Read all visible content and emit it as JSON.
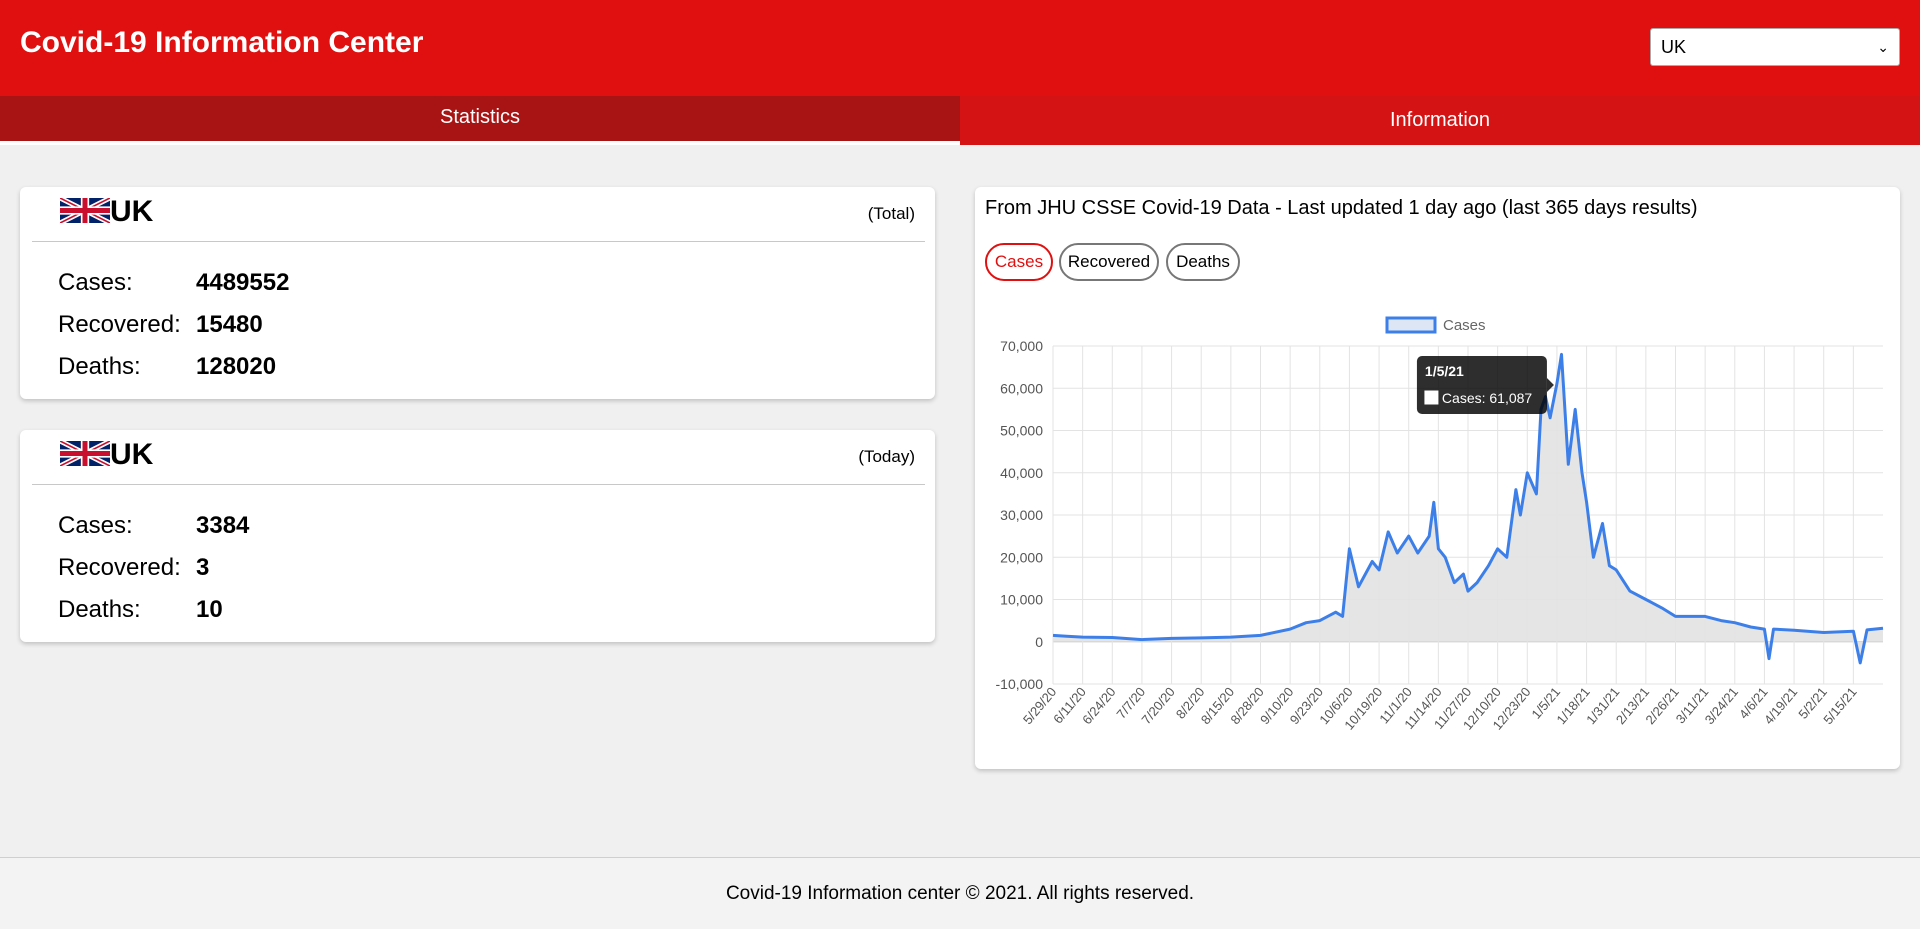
{
  "app": {
    "title": "Covid-19 Information Center"
  },
  "country_select": {
    "value": "UK"
  },
  "tabs": [
    {
      "label": "Statistics",
      "active": true
    },
    {
      "label": "Information",
      "active": false
    }
  ],
  "total_card": {
    "country": "UK",
    "scope": "(Total)",
    "rows": [
      {
        "label": "Cases:",
        "value": "4489552"
      },
      {
        "label": "Recovered:",
        "value": "15480"
      },
      {
        "label": "Deaths:",
        "value": "128020"
      }
    ]
  },
  "today_card": {
    "country": "UK",
    "scope": "(Today)",
    "rows": [
      {
        "label": "Cases:",
        "value": "3384"
      },
      {
        "label": "Recovered:",
        "value": "3"
      },
      {
        "label": "Deaths:",
        "value": "10"
      }
    ]
  },
  "chart_panel": {
    "source": "From JHU CSSE Covid-19 Data - Last updated 1 day ago (last 365 days results)",
    "filters": [
      {
        "label": "Cases",
        "active": true
      },
      {
        "label": "Recovered",
        "active": false
      },
      {
        "label": "Deaths",
        "active": false
      }
    ],
    "tooltip": {
      "title": "1/5/21",
      "label": "Cases: 61,087"
    }
  },
  "colors": {
    "header": "#e01010",
    "tab_active": "#a81414",
    "tab_inactive": "#d41414",
    "series_line": "#3d7fe8",
    "series_fill": "#e2e2e2"
  },
  "chart_data": {
    "type": "area",
    "legend": [
      "Cases"
    ],
    "legend_position": "top",
    "grid": true,
    "ylim": [
      -10000,
      70000
    ],
    "yticks": [
      "70,000",
      "60,000",
      "50,000",
      "40,000",
      "30,000",
      "20,000",
      "10,000",
      "0",
      "-10,000"
    ],
    "xticks": [
      "5/29/20",
      "6/11/20",
      "6/24/20",
      "7/7/20",
      "7/20/20",
      "8/2/20",
      "8/15/20",
      "8/28/20",
      "9/10/20",
      "9/23/20",
      "10/6/20",
      "10/19/20",
      "11/1/20",
      "11/14/20",
      "11/27/20",
      "12/10/20",
      "12/23/20",
      "1/5/21",
      "1/18/21",
      "1/31/21",
      "2/13/21",
      "2/26/21",
      "3/11/21",
      "3/24/21",
      "4/6/21",
      "4/19/21",
      "5/2/21",
      "5/15/21"
    ],
    "series": [
      {
        "name": "Cases",
        "x": [
          "5/29/20",
          "6/4/20",
          "6/11/20",
          "6/24/20",
          "7/7/20",
          "7/20/20",
          "8/2/20",
          "8/15/20",
          "8/28/20",
          "9/10/20",
          "9/17/20",
          "9/23/20",
          "9/30/20",
          "10/3/20",
          "10/6/20",
          "10/10/20",
          "10/16/20",
          "10/19/20",
          "10/23/20",
          "10/27/20",
          "11/1/20",
          "11/5/20",
          "11/10/20",
          "11/12/20",
          "11/14/20",
          "11/17/20",
          "11/21/20",
          "11/25/20",
          "11/27/20",
          "12/1/20",
          "12/6/20",
          "12/10/20",
          "12/14/20",
          "12/18/20",
          "12/20/20",
          "12/23/20",
          "12/27/20",
          "12/29/20",
          "12/31/20",
          "1/2/21",
          "1/5/21",
          "1/7/21",
          "1/10/21",
          "1/13/21",
          "1/16/21",
          "1/18/21",
          "1/21/21",
          "1/25/21",
          "1/28/21",
          "1/31/21",
          "2/6/21",
          "2/13/21",
          "2/20/21",
          "2/26/21",
          "3/4/21",
          "3/11/21",
          "3/18/21",
          "3/24/21",
          "3/31/21",
          "4/6/21",
          "4/8/21",
          "4/10/21",
          "4/19/21",
          "5/2/21",
          "5/15/21",
          "5/18/21",
          "5/21/21",
          "5/28/21"
        ],
        "values": [
          1500,
          1300,
          1100,
          1000,
          500,
          800,
          900,
          1100,
          1500,
          3000,
          4500,
          5000,
          7000,
          6000,
          22000,
          13000,
          19000,
          17000,
          26000,
          21000,
          25000,
          21000,
          25000,
          33000,
          22000,
          20000,
          14000,
          16000,
          12000,
          14000,
          18000,
          22000,
          20000,
          36000,
          30000,
          40000,
          35000,
          55000,
          58000,
          53000,
          61087,
          68000,
          42000,
          55000,
          40000,
          33000,
          20000,
          28000,
          18000,
          17000,
          12000,
          10000,
          8000,
          6000,
          6000,
          6000,
          5000,
          4500,
          3500,
          3000,
          -4000,
          3000,
          2700,
          2200,
          2500,
          -5000,
          2800,
          3200
        ]
      }
    ]
  }
}
